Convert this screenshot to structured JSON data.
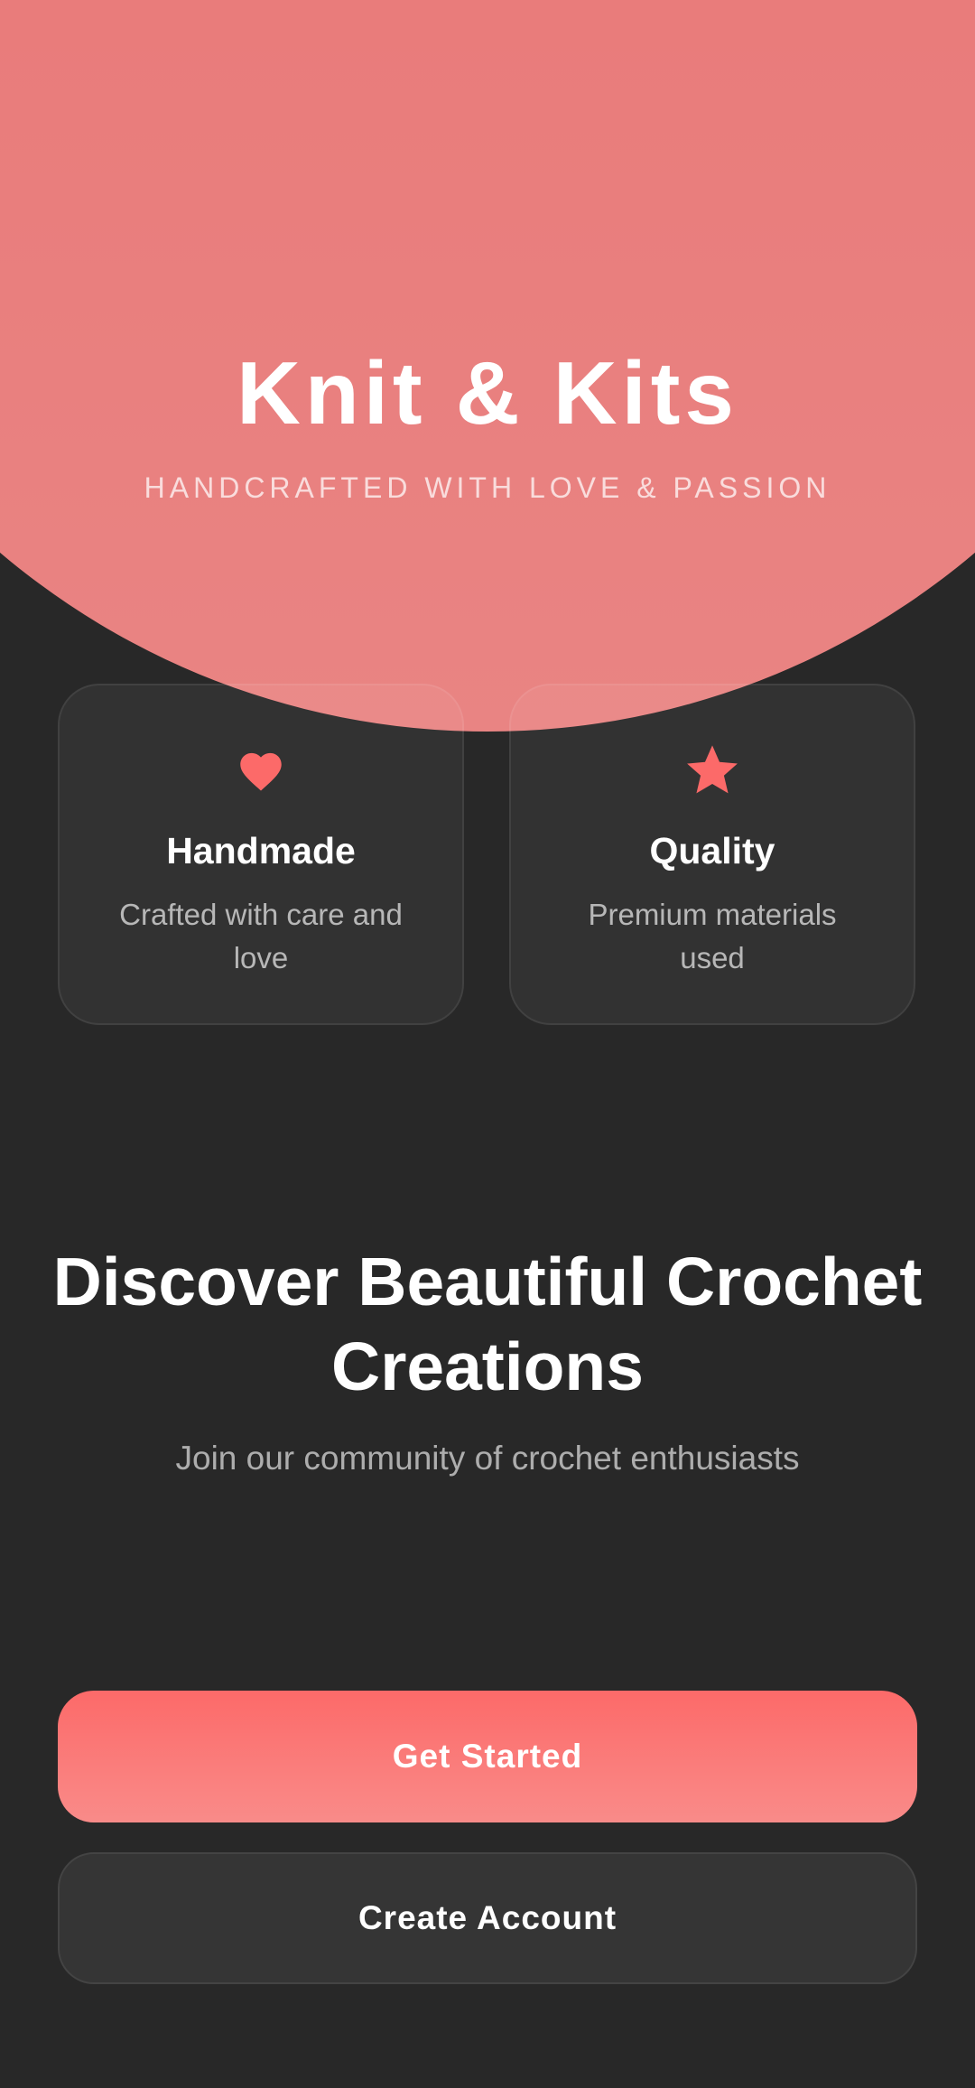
{
  "header": {
    "app_title": "Knit & Kits",
    "tagline": "HANDCRAFTED WITH LOVE & PASSION"
  },
  "features": [
    {
      "icon": "heart-icon",
      "title": "Handmade",
      "description": "Crafted with care and love"
    },
    {
      "icon": "star-icon",
      "title": "Quality",
      "description": "Premium materials used"
    }
  ],
  "promo": {
    "headline": "Discover Beautiful Crochet Creations",
    "subtitle": "Join our community of crochet enthusiasts"
  },
  "actions": {
    "get_started_label": "Get Started",
    "create_account_label": "Create Account"
  },
  "colors": {
    "accent": "#fc6a69",
    "hero": "#e97372",
    "background": "#282828",
    "card": "#2f2f2f"
  }
}
